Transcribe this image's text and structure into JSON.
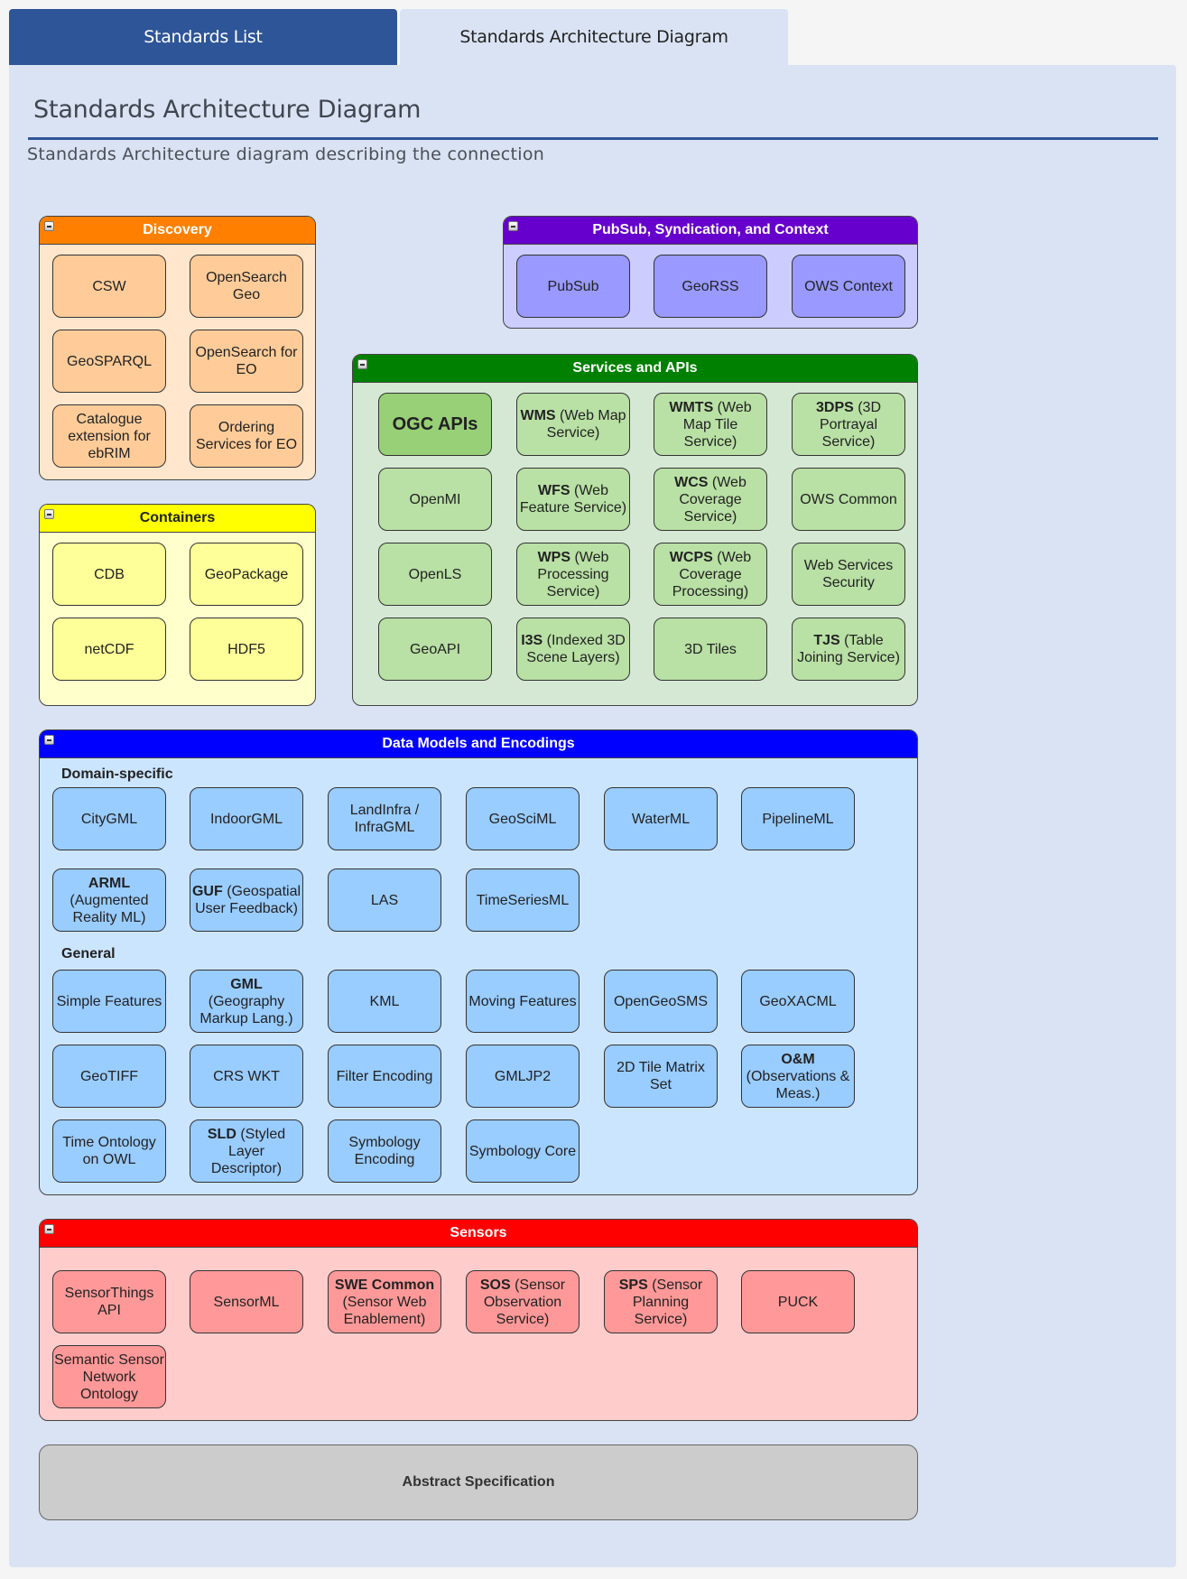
{
  "tabs": [
    {
      "label": "Standards List",
      "active": false
    },
    {
      "label": "Standards Architecture Diagram",
      "active": true
    }
  ],
  "page": {
    "title": "Standards Architecture Diagram",
    "subtitle": "Standards Architecture diagram describing the connection"
  },
  "colors": {
    "tab_active_bg": "#dae3f3",
    "tab_inactive_bg": "#2e5597",
    "discovery": "#ff8000",
    "containers": "#ffff00",
    "pubsub": "#6600cc",
    "services": "#008000",
    "data_models": "#0000ff",
    "sensors": "#ff0000",
    "abstract": "#cccccc"
  },
  "diagram": {
    "discovery": {
      "title": "Discovery",
      "items": [
        {
          "bold": "",
          "text": "CSW"
        },
        {
          "bold": "",
          "text": "OpenSearch Geo"
        },
        {
          "bold": "",
          "text": "GeoSPARQL"
        },
        {
          "bold": "",
          "text": "OpenSearch for EO"
        },
        {
          "bold": "",
          "text": "Catalogue extension for ebRIM"
        },
        {
          "bold": "",
          "text": "Ordering Services for EO"
        }
      ]
    },
    "containers": {
      "title": "Containers",
      "items": [
        {
          "bold": "",
          "text": "CDB"
        },
        {
          "bold": "",
          "text": "GeoPackage"
        },
        {
          "bold": "",
          "text": "netCDF"
        },
        {
          "bold": "",
          "text": "HDF5"
        }
      ]
    },
    "pubsub": {
      "title": "PubSub, Syndication, and Context",
      "items": [
        {
          "bold": "",
          "text": "PubSub"
        },
        {
          "bold": "",
          "text": "GeoRSS"
        },
        {
          "bold": "",
          "text": "OWS Context"
        }
      ]
    },
    "services": {
      "title": "Services and APIs",
      "items": [
        {
          "bold": "OGC APIs",
          "text": ""
        },
        {
          "bold": "WMS",
          "text": " (Web Map Service)"
        },
        {
          "bold": "WMTS",
          "text": " (Web Map Tile Service)"
        },
        {
          "bold": "3DPS",
          "text": " (3D Portrayal Service)"
        },
        {
          "bold": "",
          "text": "OpenMI"
        },
        {
          "bold": "WFS",
          "text": " (Web Feature Service)"
        },
        {
          "bold": "WCS",
          "text": " (Web Coverage Service)"
        },
        {
          "bold": "",
          "text": "OWS Common"
        },
        {
          "bold": "",
          "text": "OpenLS"
        },
        {
          "bold": "WPS",
          "text": " (Web Processing Service)"
        },
        {
          "bold": "WCPS",
          "text": " (Web Coverage Processing)"
        },
        {
          "bold": "",
          "text": "Web Services Security"
        },
        {
          "bold": "",
          "text": "GeoAPI"
        },
        {
          "bold": "I3S",
          "text": " (Indexed 3D Scene Layers)"
        },
        {
          "bold": "",
          "text": "3D Tiles"
        },
        {
          "bold": "TJS",
          "text": " (Table Joining Service)"
        }
      ]
    },
    "data_models": {
      "title": "Data Models and Encodings",
      "domain_label": "Domain-specific",
      "domain_items": [
        {
          "bold": "",
          "text": "CityGML"
        },
        {
          "bold": "",
          "text": "IndoorGML"
        },
        {
          "bold": "",
          "text": "LandInfra / InfraGML"
        },
        {
          "bold": "",
          "text": "GeoSciML"
        },
        {
          "bold": "",
          "text": "WaterML"
        },
        {
          "bold": "",
          "text": "PipelineML"
        },
        {
          "bold": "ARML",
          "text": " (Augmented Reality ML)"
        },
        {
          "bold": "GUF",
          "text": " (Geospatial User Feedback)"
        },
        {
          "bold": "",
          "text": "LAS"
        },
        {
          "bold": "",
          "text": "TimeSeriesML"
        }
      ],
      "general_label": "General",
      "general_items": [
        {
          "bold": "",
          "text": "Simple Features"
        },
        {
          "bold": "GML",
          "text": " (Geography Markup Lang.)"
        },
        {
          "bold": "",
          "text": "KML"
        },
        {
          "bold": "",
          "text": "Moving Features"
        },
        {
          "bold": "",
          "text": "OpenGeoSMS"
        },
        {
          "bold": "",
          "text": "GeoXACML"
        },
        {
          "bold": "",
          "text": "GeoTIFF"
        },
        {
          "bold": "",
          "text": "CRS WKT"
        },
        {
          "bold": "",
          "text": "Filter Encoding"
        },
        {
          "bold": "",
          "text": "GMLJP2"
        },
        {
          "bold": "",
          "text": "2D Tile Matrix Set"
        },
        {
          "bold": "O&M",
          "text": " (Observations & Meas.)"
        },
        {
          "bold": "",
          "text": "Time Ontology on OWL"
        },
        {
          "bold": "SLD",
          "text": " (Styled Layer Descriptor)"
        },
        {
          "bold": "",
          "text": "Symbology Encoding"
        },
        {
          "bold": "",
          "text": "Symbology Core"
        }
      ]
    },
    "sensors": {
      "title": "Sensors",
      "items": [
        {
          "bold": "",
          "text": "SensorThings API"
        },
        {
          "bold": "",
          "text": "SensorML"
        },
        {
          "bold": "SWE Common",
          "text": " (Sensor Web Enablement)"
        },
        {
          "bold": "SOS",
          "text": " (Sensor Observation Service)"
        },
        {
          "bold": "SPS",
          "text": " (Sensor Planning Service)"
        },
        {
          "bold": "",
          "text": "PUCK"
        },
        {
          "bold": "",
          "text": "Semantic Sensor Network Ontology"
        }
      ]
    },
    "abstract": {
      "title": "Abstract Specification"
    }
  }
}
